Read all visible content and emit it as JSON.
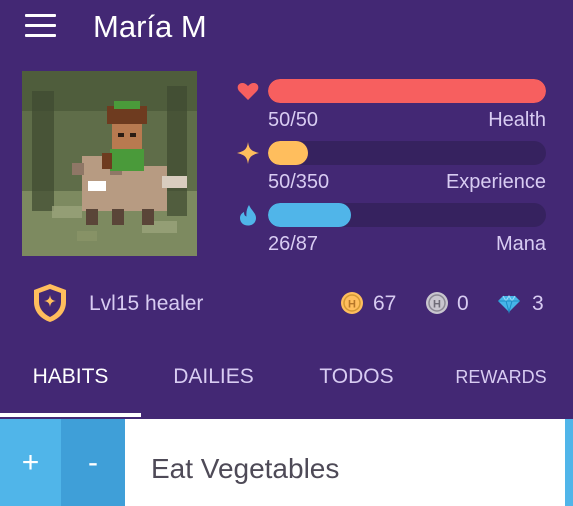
{
  "header": {
    "menu_icon": "hamburger-menu-icon",
    "user_name": "María M"
  },
  "avatar": {
    "description_icon": "avatar-icon"
  },
  "stats": {
    "health": {
      "icon": "heart-icon",
      "value_text": "50/50",
      "label": "Health",
      "current": 50,
      "max": 50,
      "color": "#f75f5f"
    },
    "experience": {
      "icon": "star-icon",
      "value_text": "50/350",
      "label": "Experience",
      "current": 50,
      "max": 350,
      "color": "#ffbe5d"
    },
    "mana": {
      "icon": "droplet-icon",
      "value_text": "26/87",
      "label": "Mana",
      "current": 26,
      "max": 87,
      "color": "#50b5e9"
    }
  },
  "profile": {
    "level_icon": "shield-icon",
    "level_text": "Lvl15 healer"
  },
  "currency": {
    "gold": {
      "icon": "gold-coin-icon",
      "value": "67"
    },
    "hourglass": {
      "icon": "hourglass-coin-icon",
      "value": "0"
    },
    "gems": {
      "icon": "gem-icon",
      "value": "3"
    }
  },
  "tabs": [
    {
      "label": "HABITS",
      "active": true
    },
    {
      "label": "DAILIES",
      "active": false
    },
    {
      "label": "TODOS",
      "active": false
    },
    {
      "label": "REWARDS",
      "active": false
    }
  ],
  "task": {
    "plus_label": "+",
    "minus_label": "-",
    "text": "Eat Vegetables"
  },
  "colors": {
    "background": "#432874",
    "health": "#f75f5f",
    "experience": "#ffbe5d",
    "mana": "#50b5e9",
    "muted_text": "#d8ccf2"
  }
}
